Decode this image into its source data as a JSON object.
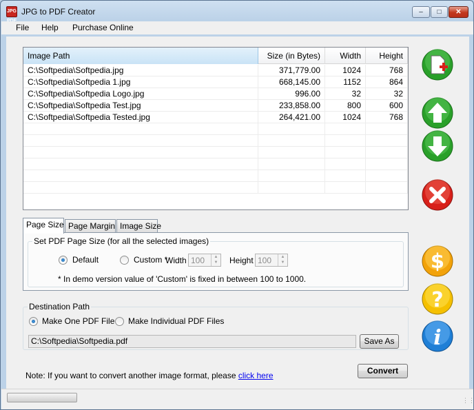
{
  "window": {
    "title": "JPG to PDF Creator",
    "icon_label": "JPG PDF"
  },
  "menu": [
    "File",
    "Help",
    "Purchase Online"
  ],
  "table": {
    "columns": [
      "Image Path",
      "Size (in Bytes)",
      "Width",
      "Height"
    ],
    "rows": [
      [
        "C:\\Softpedia\\Softpedia.jpg",
        "371,779.00",
        "1024",
        "768"
      ],
      [
        "C:\\Softpedia\\Softpedia 1.jpg",
        "668,145.00",
        "1152",
        "864"
      ],
      [
        "C:\\Softpedia\\Softpedia Logo.jpg",
        "996.00",
        "32",
        "32"
      ],
      [
        "C:\\Softpedia\\Softpedia Test.jpg",
        "233,858.00",
        "800",
        "600"
      ],
      [
        "C:\\Softpedia\\Softpedia Tested.jpg",
        "264,421.00",
        "1024",
        "768"
      ]
    ]
  },
  "tabs": [
    "Page Size",
    "Page Margin",
    "Image Size"
  ],
  "page_size": {
    "group_title": "Set PDF Page Size (for all the selected images)",
    "default_label": "Default",
    "custom_label": "Custom *",
    "width_label": "Width",
    "width_value": "100",
    "height_label": "Height",
    "height_value": "100",
    "note": "* In demo version value of 'Custom' is fixed in between 100 to 1000."
  },
  "destination": {
    "group_title": "Destination Path",
    "one_pdf_label": "Make One PDF File",
    "individual_label": "Make Individual PDF Files",
    "path_value": "C:\\Softpedia\\Softpedia.pdf",
    "save_as_label": "Save As"
  },
  "footer": {
    "note_text": "Note: If you want to convert another image format, please",
    "note_link": "click here",
    "convert_label": "Convert"
  },
  "side_icons": [
    "add-image-icon",
    "move-up-icon",
    "move-down-icon",
    "delete-icon",
    "purchase-dollar-icon",
    "help-icon",
    "info-icon"
  ],
  "colors": {
    "green": "#2aa02a",
    "red": "#d8201a",
    "orange": "#f2a20a"
  }
}
